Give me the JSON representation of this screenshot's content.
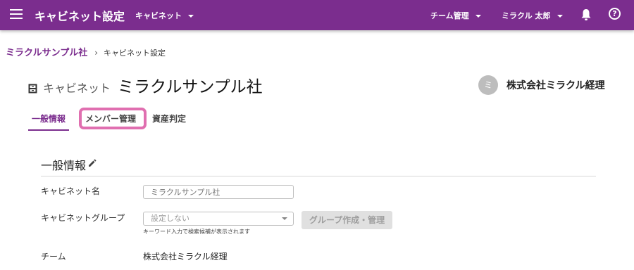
{
  "header": {
    "app_title": "キャビネット設定",
    "cabinet_dropdown": "キャビネット",
    "team_dropdown": "チーム管理",
    "user_dropdown": "ミラクル 太郎",
    "help_symbol": "?",
    "icons": [
      "menu-icon",
      "bell-icon",
      "help-icon"
    ]
  },
  "breadcrumb": {
    "root": "ミラクルサンプル社",
    "separator": "›",
    "current": "キャビネット設定"
  },
  "page_header": {
    "prefix": "キャビネット",
    "title": "ミラクルサンプル社",
    "icon": "cabinet-icon"
  },
  "team": {
    "avatar_initial": "ミ",
    "name": "株式会社ミラクル経理"
  },
  "tabs": [
    {
      "label": "一般情報",
      "active": true
    },
    {
      "label": "メンバー管理",
      "active": false,
      "highlighted": true
    },
    {
      "label": "資産判定",
      "active": false
    }
  ],
  "general": {
    "section_title": "一般情報",
    "cabinet_name_label": "キャビネット名",
    "cabinet_name_placeholder": "ミラクルサンプル社",
    "cabinet_group_label": "キャビネットグループ",
    "cabinet_group_placeholder": "設定しない",
    "cabinet_group_hint": "キーワード入力で検索候補が表示されます",
    "group_button_label": "グループ作成・管理",
    "team_label": "チーム",
    "team_value": "株式会社ミラクル経理"
  },
  "colors": {
    "brand": "#7b2d8e",
    "highlight": "#e06fb0",
    "disabled_button": "#e0e0e0"
  }
}
